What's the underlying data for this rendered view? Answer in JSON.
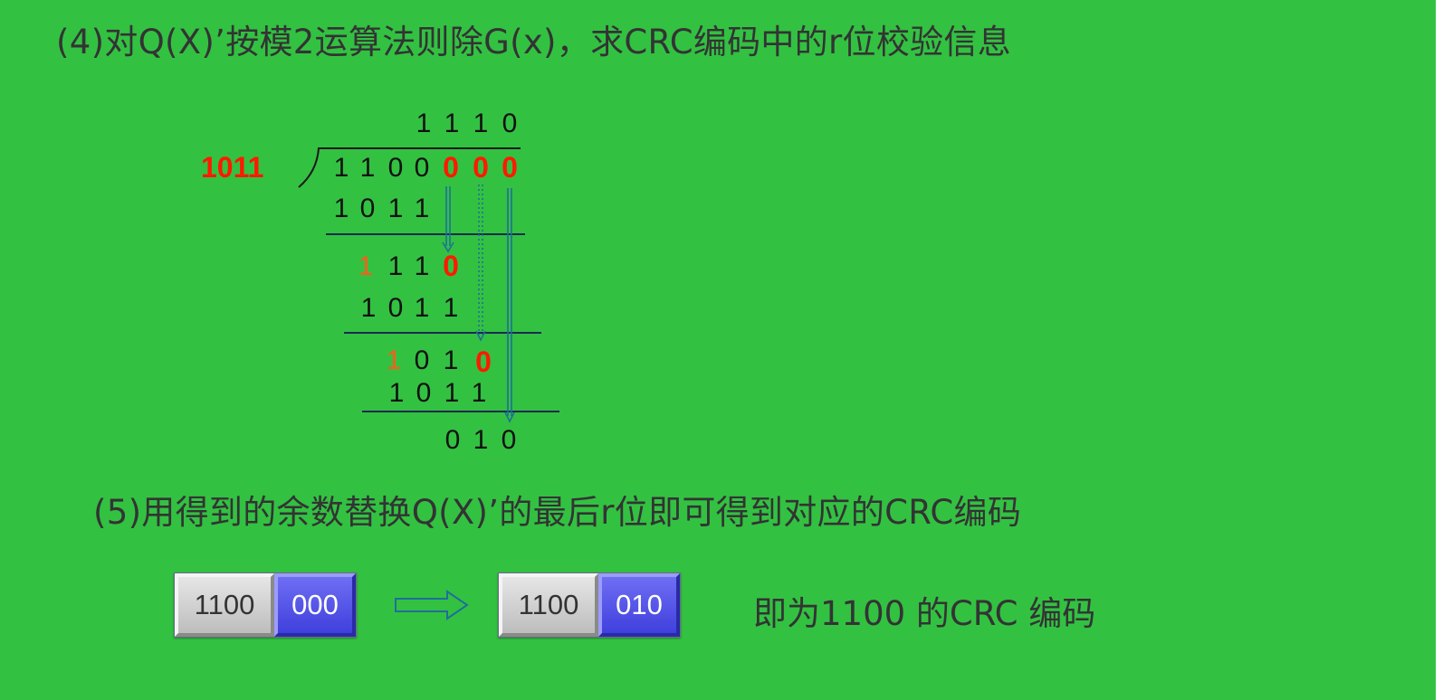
{
  "step4_text": "(4)对Q(X)’按模2运算法则除G(x)，求CRC编码中的r位校验信息",
  "step5_text": "(5)用得到的余数替换Q(X)’的最后r位即可得到对应的CRC编码",
  "divisor": "1011",
  "quotient": [
    "1",
    "1",
    "1",
    "0"
  ],
  "dividend": [
    "1",
    "1",
    "0",
    "0",
    "0",
    "0",
    "0"
  ],
  "sub1": [
    "1",
    "0",
    "1",
    "1"
  ],
  "rem1": [
    "1",
    "1",
    "1",
    "0"
  ],
  "sub2": [
    "1",
    "0",
    "1",
    "1"
  ],
  "rem2": [
    "1",
    "0",
    "1",
    "0"
  ],
  "sub3": [
    "1",
    "0",
    "1",
    "1"
  ],
  "remainder": [
    "0",
    "1",
    "0"
  ],
  "before": {
    "data": "1100",
    "check": "000"
  },
  "after": {
    "data": "1100",
    "check": "010"
  },
  "result_text": "即为1100 的CRC 编码",
  "colors": {
    "background": "#33c142",
    "highlight": "#ff1a00",
    "check_block": "#4f4fe6",
    "arrow": "#1f6f9a"
  }
}
